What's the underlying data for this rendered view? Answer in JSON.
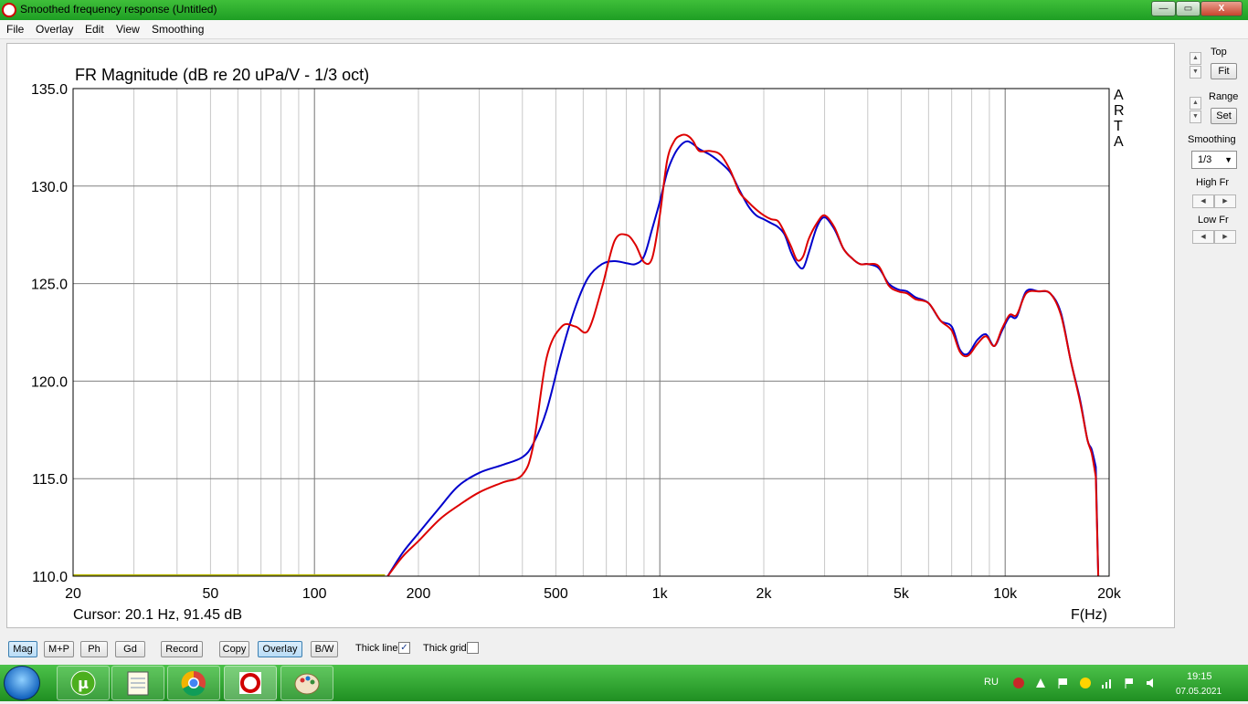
{
  "window": {
    "title": "Smoothed frequency response (Untitled)",
    "min_label": "—",
    "max_label": "▭",
    "close_label": "X"
  },
  "menu": [
    "File",
    "Overlay",
    "Edit",
    "View",
    "Smoothing"
  ],
  "chart_data": {
    "type": "line",
    "title": "FR Magnitude (dB re 20 uPa/V - 1/3 oct)",
    "xlabel": "F(Hz)",
    "x_scale": "log",
    "xlim": [
      20,
      20000
    ],
    "ylim": [
      110,
      135
    ],
    "y_ticks": [
      110,
      115,
      120,
      125,
      130,
      135
    ],
    "y_tick_labels": [
      "110.0",
      "115.0",
      "120.0",
      "125.0",
      "130.0",
      "135.0"
    ],
    "x_ticks": [
      20,
      50,
      100,
      200,
      500,
      1000,
      2000,
      5000,
      10000,
      20000
    ],
    "x_tick_labels": [
      "20",
      "50",
      "100",
      "200",
      "500",
      "1k",
      "2k",
      "5k",
      "10k",
      "20k"
    ],
    "grid": true,
    "side_label": [
      "A",
      "R",
      "T",
      "A"
    ],
    "cursor_readout": "Cursor: 20.1 Hz, 91.45 dB",
    "series": [
      {
        "color": "#0000cc",
        "x": [
          163,
          180,
          200,
          230,
          260,
          300,
          350,
          400,
          430,
          470,
          520,
          570,
          620,
          680,
          740,
          800,
          850,
          900,
          950,
          1000,
          1050,
          1100,
          1150,
          1200,
          1250,
          1300,
          1400,
          1500,
          1600,
          1700,
          1800,
          1900,
          2000,
          2100,
          2200,
          2300,
          2400,
          2500,
          2600,
          2700,
          2850,
          3000,
          3200,
          3400,
          3600,
          3800,
          4000,
          4300,
          4600,
          4900,
          5200,
          5500,
          6000,
          6500,
          7000,
          7400,
          7800,
          8300,
          8800,
          9300,
          9800,
          10300,
          10800,
          11500,
          12500,
          13500,
          14500,
          15500,
          16500,
          17300,
          17800,
          18300
        ],
        "y": [
          110,
          111.2,
          112.2,
          113.5,
          114.6,
          115.3,
          115.7,
          116.1,
          116.8,
          118.5,
          121.5,
          123.8,
          125.3,
          126.0,
          126.15,
          126.05,
          126.0,
          126.4,
          127.8,
          129.2,
          130.7,
          131.6,
          132.1,
          132.3,
          132.15,
          131.9,
          131.6,
          131.2,
          130.7,
          129.8,
          129.0,
          128.5,
          128.3,
          128.1,
          127.9,
          127.5,
          126.6,
          126.0,
          125.8,
          126.6,
          127.9,
          128.4,
          127.8,
          126.8,
          126.3,
          126.0,
          126.0,
          125.8,
          125.0,
          124.7,
          124.6,
          124.3,
          124.0,
          123.1,
          122.8,
          121.6,
          121.4,
          122.1,
          122.4,
          121.8,
          122.6,
          123.3,
          123.3,
          124.6,
          124.6,
          124.5,
          123.5,
          121.0,
          119.0,
          117.0,
          116.5,
          115.6
        ]
      },
      {
        "color": "#dd0000",
        "x": [
          163,
          180,
          200,
          230,
          260,
          300,
          350,
          400,
          430,
          470,
          520,
          570,
          620,
          680,
          740,
          800,
          850,
          900,
          950,
          1000,
          1050,
          1100,
          1150,
          1200,
          1250,
          1300,
          1400,
          1500,
          1600,
          1700,
          1800,
          1900,
          2000,
          2100,
          2200,
          2300,
          2400,
          2500,
          2600,
          2700,
          2850,
          3000,
          3200,
          3400,
          3600,
          3800,
          4000,
          4300,
          4600,
          4900,
          5200,
          5500,
          6000,
          6500,
          7000,
          7400,
          7800,
          8300,
          8800,
          9300,
          9800,
          10300,
          10800,
          11500,
          12500,
          13500,
          14500,
          15500,
          16500,
          17300,
          17800,
          18300
        ],
        "y": [
          110,
          111.0,
          111.8,
          112.9,
          113.6,
          114.3,
          114.8,
          115.2,
          116.7,
          121.2,
          122.8,
          122.8,
          122.6,
          124.8,
          127.2,
          127.5,
          127.0,
          126.1,
          126.3,
          128.5,
          131.3,
          132.3,
          132.6,
          132.6,
          132.3,
          131.8,
          131.8,
          131.6,
          130.8,
          129.7,
          129.2,
          128.8,
          128.5,
          128.3,
          128.2,
          127.6,
          126.9,
          126.2,
          126.4,
          127.3,
          128.1,
          128.5,
          127.9,
          126.8,
          126.3,
          126.0,
          126.0,
          125.9,
          124.9,
          124.6,
          124.5,
          124.2,
          124.0,
          123.1,
          122.6,
          121.5,
          121.3,
          121.9,
          122.3,
          121.8,
          122.7,
          123.4,
          123.4,
          124.5,
          124.6,
          124.5,
          123.4,
          121.0,
          118.9,
          117.0,
          116.3,
          115.1
        ]
      }
    ],
    "baseline_segment": {
      "color": "#b8b800",
      "x": [
        20,
        160
      ],
      "y": [
        110.05,
        110.05
      ]
    }
  },
  "right_panel": {
    "top_label": "Top",
    "fit_label": "Fit",
    "range_label": "Range",
    "set_label": "Set",
    "smoothing_label": "Smoothing",
    "smoothing_value": "1/3",
    "high_fr_label": "High Fr",
    "low_fr_label": "Low Fr"
  },
  "toolbar": {
    "buttons": [
      "Mag",
      "M+P",
      "Ph",
      "Gd",
      "Record",
      "Copy",
      "Overlay",
      "B/W"
    ],
    "active": [
      "Mag",
      "Overlay"
    ],
    "thick_line_label": "Thick line",
    "thick_line_checked": true,
    "thick_grid_label": "Thick grid",
    "thick_grid_checked": false
  },
  "taskbar": {
    "apps": [
      "utorrent",
      "notepad",
      "chrome",
      "arta",
      "paint"
    ],
    "language": "RU",
    "time": "19:15",
    "date": "07.05.2021"
  }
}
